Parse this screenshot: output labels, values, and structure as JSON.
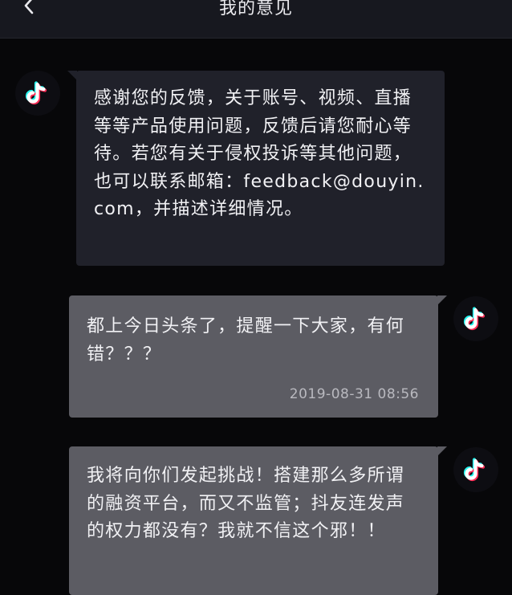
{
  "header": {
    "title": "我的意见",
    "back_icon": "chevron-left-icon"
  },
  "colors": {
    "background": "#070709",
    "header": "#17181f",
    "incoming_bubble": "#20212a",
    "outgoing_bubble": "#5c5c63",
    "logo_cyan": "#25f4ee",
    "logo_red": "#fe2c55"
  },
  "messages": [
    {
      "side": "incoming",
      "avatar_icon": "douyin-logo-icon",
      "text": "感谢您的反馈，关于账号、视频、直播等等产品使用问题，反馈后请您耐心等待。若您有关于侵权投诉等其他问题，也可以联系邮箱：feedback@douyin.com，并描述详细情况。"
    },
    {
      "side": "outgoing",
      "avatar_icon": "douyin-logo-icon",
      "text": "都上今日头条了，提醒一下大家，有何错？？？",
      "time": "2019-08-31 08:56"
    },
    {
      "side": "outgoing",
      "avatar_icon": "douyin-logo-icon",
      "text": "我将向你们发起挑战！搭建那么多所谓的融资平台，而又不监管；抖友连发声的权力都没有？我就不信这个邪！！"
    }
  ]
}
